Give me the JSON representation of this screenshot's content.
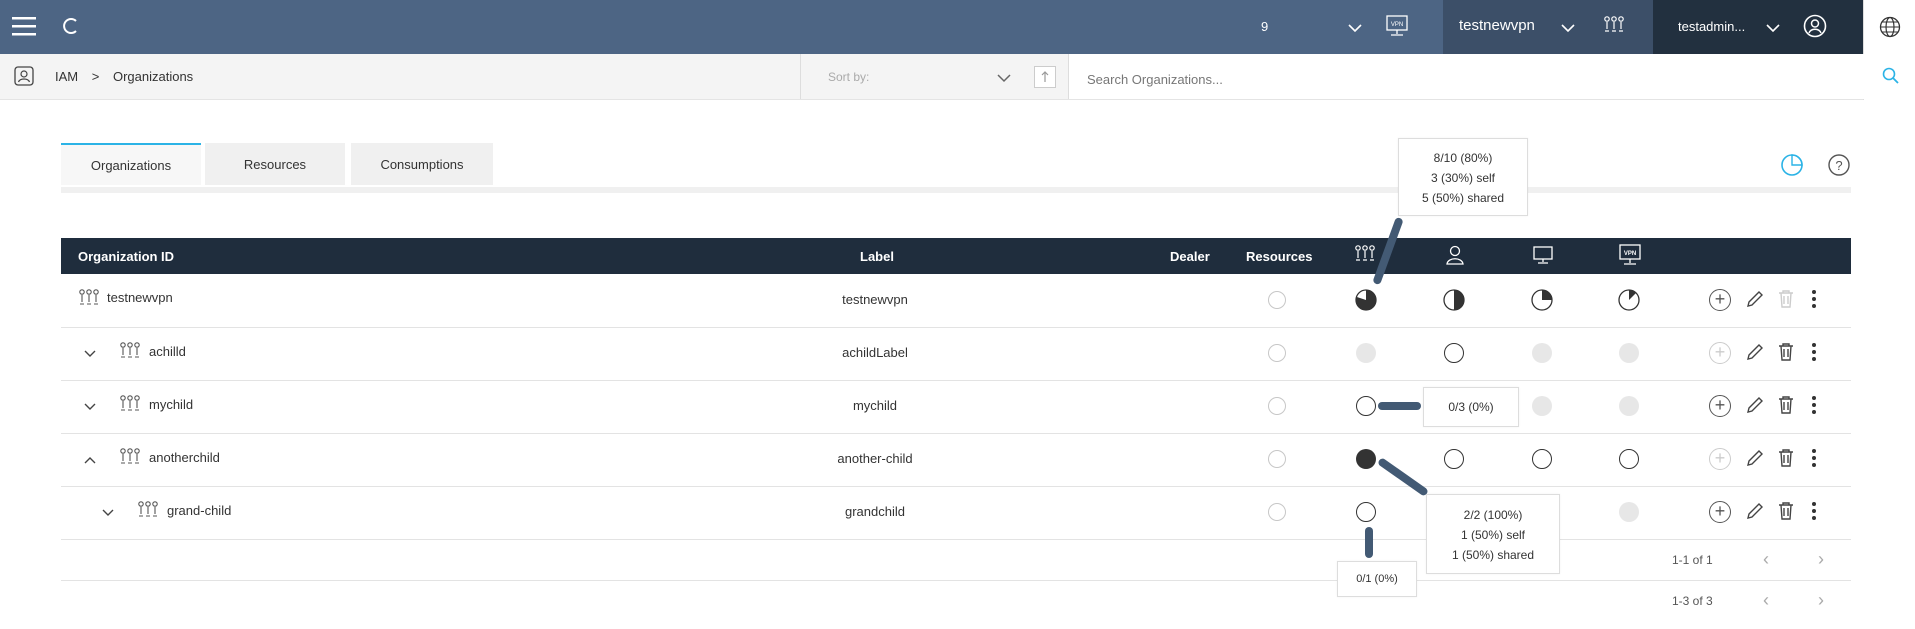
{
  "topbar": {
    "count": "9",
    "org_name": "testnewvpn",
    "user_name": "testadmin..."
  },
  "breadcrumb": {
    "items": [
      "IAM",
      ">",
      "Organizations"
    ]
  },
  "sort": {
    "placeholder": "Sort by:"
  },
  "search": {
    "placeholder": "Search Organizations..."
  },
  "tabs": [
    {
      "label": "Organizations",
      "active": true
    },
    {
      "label": "Resources",
      "active": false
    },
    {
      "label": "Consumptions",
      "active": false
    }
  ],
  "table": {
    "headers": {
      "org_id": "Organization ID",
      "label": "Label",
      "dealer": "Dealer",
      "resources": "Resources"
    },
    "rows": [
      {
        "name": "testnewvpn",
        "label": "testnewvpn",
        "expander": "",
        "level": 0
      },
      {
        "name": "achilld",
        "label": "achildLabel",
        "expander": "collapsed",
        "level": 1
      },
      {
        "name": "mychild",
        "label": "mychild",
        "expander": "collapsed",
        "level": 1
      },
      {
        "name": "anotherchild",
        "label": "another-child",
        "expander": "expanded",
        "level": 1
      },
      {
        "name": "grand-child",
        "label": "grandchild",
        "expander": "collapsed",
        "level": 2
      }
    ]
  },
  "tooltips": {
    "testnewvpn_orgs": [
      "8/10 (80%)",
      "3 (30%) self",
      "5 (50%) shared"
    ],
    "mychild_orgs": "0/3 (0%)",
    "anotherchild_orgs": [
      "2/2 (100%)",
      "1 (50%) self",
      "1 (50%) shared"
    ],
    "grandchild_orgs": "0/1 (0%)"
  },
  "pagination": {
    "inner": "1-1 of 1",
    "outer": "1-3 of 3"
  },
  "colors": {
    "topbar": "#4d6584",
    "topbar_dark": "#22303f",
    "table_header": "#1f2d3d",
    "accent": "#2bb3e6"
  }
}
